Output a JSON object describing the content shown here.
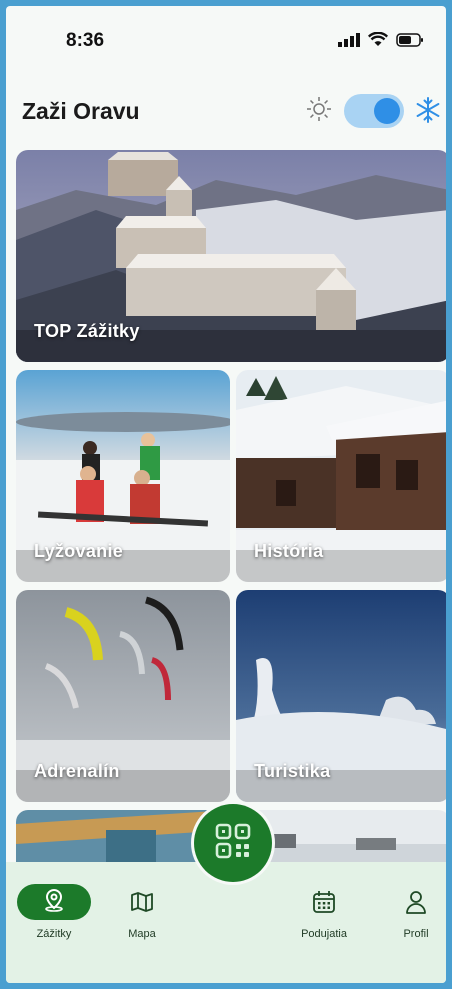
{
  "status_bar": {
    "time": "8:36"
  },
  "header": {
    "title": "Zaži Oravu",
    "season_toggle": "winter"
  },
  "cards": {
    "top": "TOP Zážitky",
    "lyzovanie": "Lyžovanie",
    "historia": "História",
    "adrenalin": "Adrenalín",
    "turistika": "Turistika"
  },
  "nav": {
    "zazitky": "Zážitky",
    "mapa": "Mapa",
    "podujatia": "Podujatia",
    "profil": "Profil"
  },
  "colors": {
    "accent": "#1c7a2a",
    "toggle_knob": "#2f8fe6",
    "nav_bg": "#e3f2e6"
  }
}
